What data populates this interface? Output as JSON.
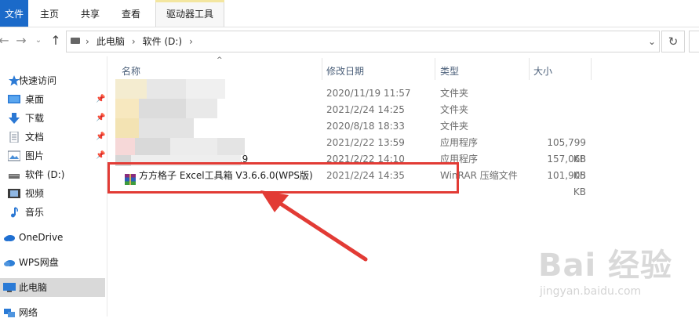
{
  "ribbon": {
    "tabs": [
      "文件",
      "主页",
      "共享",
      "查看",
      "驱动器工具"
    ]
  },
  "address": {
    "crumbs": [
      "此电脑",
      "软件 (D:)"
    ]
  },
  "sidebar": {
    "items": [
      {
        "label": "快速访问",
        "icon": "star-icon"
      },
      {
        "label": "桌面",
        "icon": "desktop-icon",
        "pinned": true
      },
      {
        "label": "下载",
        "icon": "download-icon",
        "pinned": true
      },
      {
        "label": "文档",
        "icon": "document-icon",
        "pinned": true
      },
      {
        "label": "图片",
        "icon": "picture-icon",
        "pinned": true
      },
      {
        "label": "软件 (D:)",
        "icon": "drive-icon"
      },
      {
        "label": "视频",
        "icon": "video-icon"
      },
      {
        "label": "音乐",
        "icon": "music-icon"
      },
      {
        "label": "OneDrive",
        "icon": "cloud-icon"
      },
      {
        "label": "WPS网盘",
        "icon": "cloud-icon"
      },
      {
        "label": "此电脑",
        "icon": "computer-icon",
        "selected": true
      },
      {
        "label": "网络",
        "icon": "network-icon"
      }
    ]
  },
  "columns": {
    "name": "名称",
    "date": "修改日期",
    "type": "类型",
    "size": "大小"
  },
  "files": [
    {
      "name": "",
      "date": "2020/11/19 11:57",
      "type": "文件夹",
      "size": ""
    },
    {
      "name": "",
      "date": "2021/2/24 14:25",
      "type": "文件夹",
      "size": ""
    },
    {
      "name": "",
      "date": "2020/8/18 18:33",
      "type": "文件夹",
      "size": ""
    },
    {
      "name": "",
      "date": "2021/2/22 13:59",
      "type": "应用程序",
      "size": "105,799 KB"
    },
    {
      "name": "19",
      "date": "2021/2/22 14:10",
      "type": "应用程序",
      "size": "157,068 KB"
    },
    {
      "name": "方方格子 Excel工具箱 V3.6.6.0(WPS版)",
      "date": "2021/2/24 14:35",
      "type": "WinRAR 压缩文件",
      "size": "101,905 KB"
    }
  ],
  "watermark": {
    "brand": "Bai 经验",
    "url": "jingyan.baidu.com"
  },
  "colors": {
    "file_tab": "#1b6ac9",
    "highlight": "#e23b35",
    "selected_bg": "#d9d9d9"
  }
}
